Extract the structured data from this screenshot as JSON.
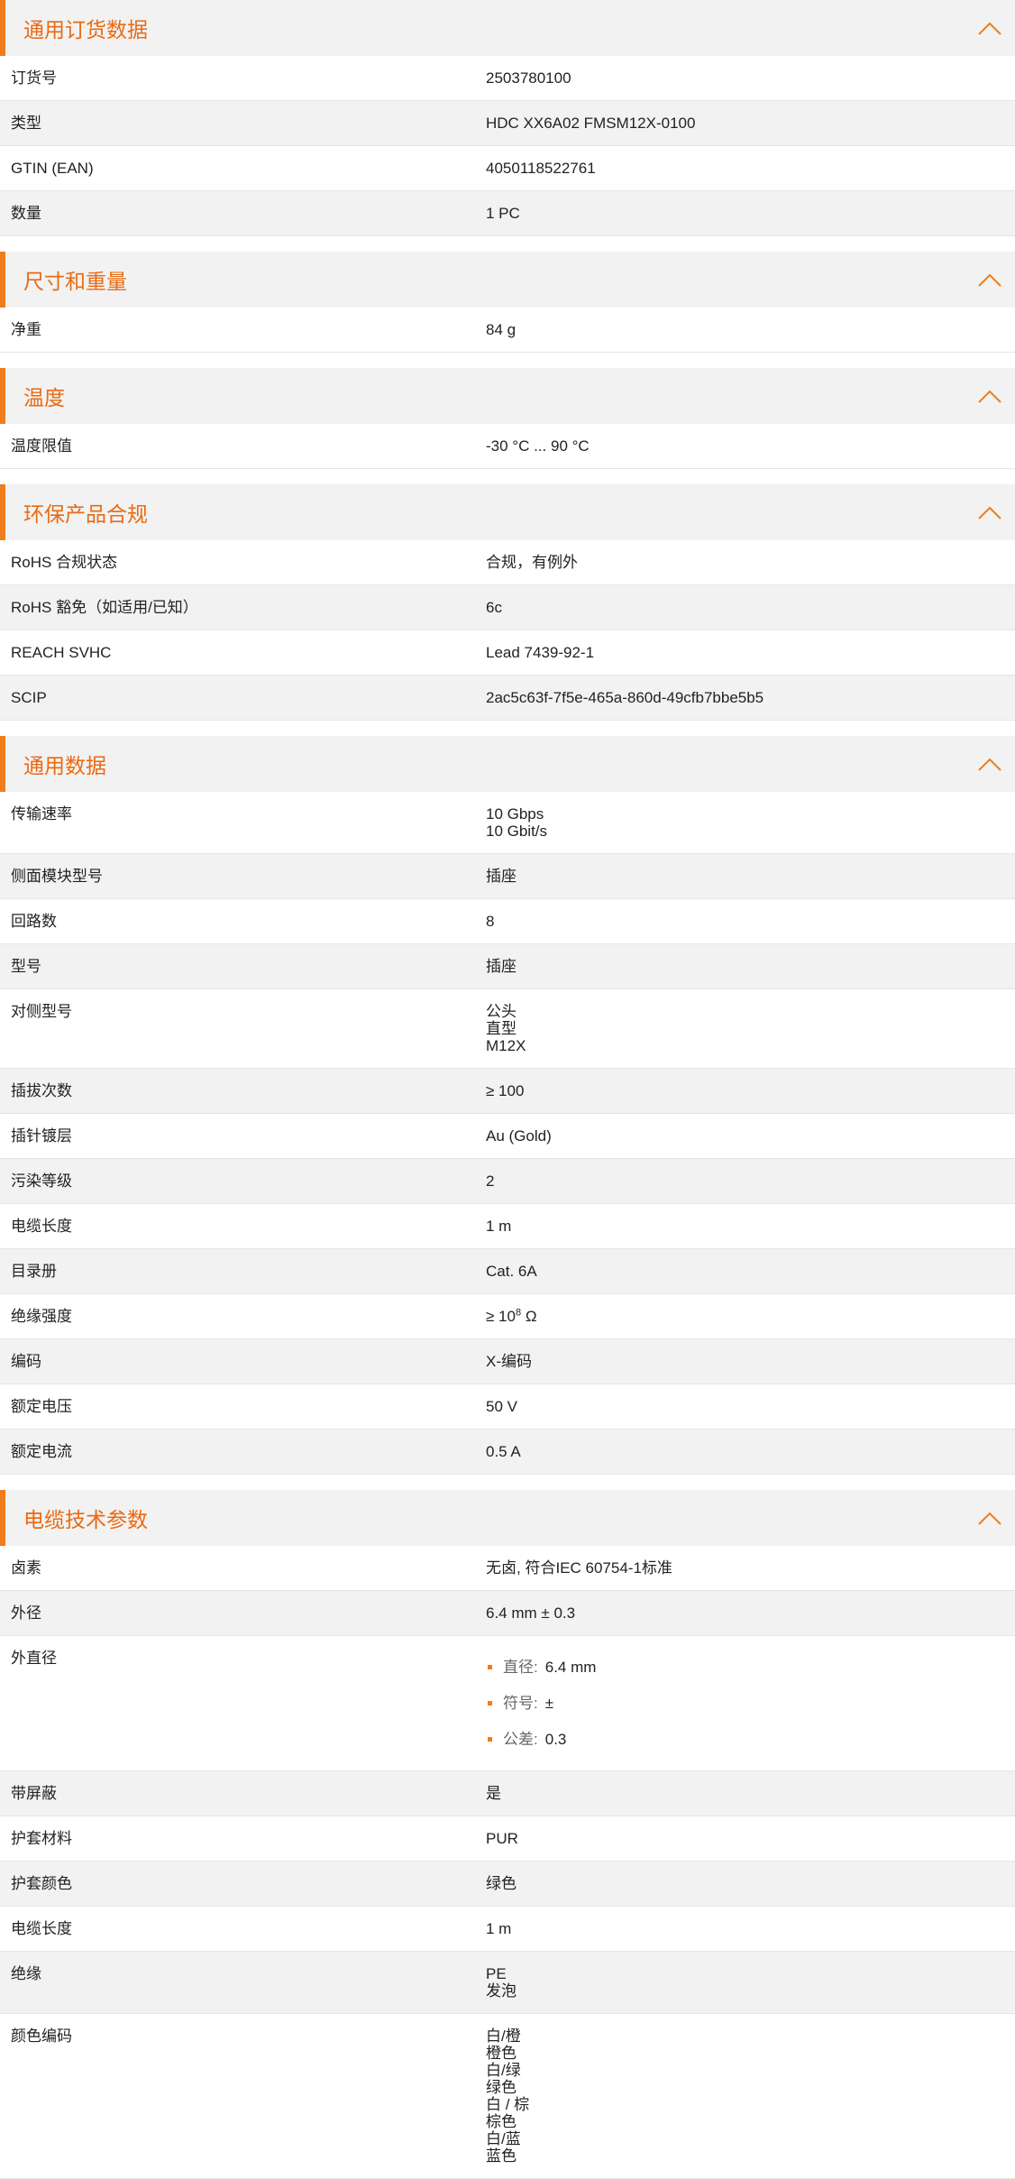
{
  "colors": {
    "accent": "#f07d1b",
    "title": "#ea6a12",
    "row_alt": "#f2f2f2",
    "header_bg": "#f2f2f2"
  },
  "sections": [
    {
      "title": "通用订货数据",
      "icon": "chevron-up-icon",
      "rows": [
        {
          "label": "订货号",
          "lines": [
            "2503780100"
          ]
        },
        {
          "label": "类型",
          "lines": [
            "HDC XX6A02 FMSM12X-0100"
          ]
        },
        {
          "label": "GTIN (EAN)",
          "lines": [
            "4050118522761"
          ]
        },
        {
          "label": "数量",
          "lines": [
            "1  PC"
          ]
        }
      ]
    },
    {
      "title": "尺寸和重量",
      "icon": "chevron-up-icon",
      "rows": [
        {
          "label": "净重",
          "lines": [
            "84  g"
          ]
        }
      ]
    },
    {
      "title": "温度",
      "icon": "chevron-up-icon",
      "rows": [
        {
          "label": "温度限值",
          "lines": [
            "-30 °C ... 90 °C"
          ]
        }
      ]
    },
    {
      "title": "环保产品合规",
      "icon": "chevron-up-icon",
      "rows": [
        {
          "label": "RoHS 合规状态",
          "lines": [
            "合规，有例外"
          ]
        },
        {
          "label": "RoHS 豁免（如适用/已知）",
          "lines": [
            "6c"
          ]
        },
        {
          "label": "REACH SVHC",
          "lines": [
            "Lead 7439-92-1"
          ]
        },
        {
          "label": "SCIP",
          "lines": [
            "2ac5c63f-7f5e-465a-860d-49cfb7bbe5b5"
          ]
        }
      ]
    },
    {
      "title": "通用数据",
      "icon": "chevron-up-icon",
      "rows": [
        {
          "label": "传输速率",
          "lines": [
            "10 Gbps",
            "10 Gbit/s"
          ]
        },
        {
          "label": "侧面模块型号",
          "lines": [
            "插座"
          ]
        },
        {
          "label": "回路数",
          "lines": [
            "8"
          ]
        },
        {
          "label": "型号",
          "lines": [
            "插座"
          ]
        },
        {
          "label": "对侧型号",
          "lines": [
            "公头",
            "直型",
            "M12X"
          ]
        },
        {
          "label": "插拔次数",
          "lines": [
            "≥ 100"
          ]
        },
        {
          "label": "插针镀层",
          "lines": [
            "Au (Gold)"
          ]
        },
        {
          "label": "污染等级",
          "lines": [
            "2"
          ]
        },
        {
          "label": "电缆长度",
          "lines": [
            "1  m"
          ]
        },
        {
          "label": "目录册",
          "lines": [
            "Cat. 6A"
          ]
        },
        {
          "label": "绝缘强度",
          "sup": {
            "base": "≥ 10",
            "exp": "8",
            "unit": " Ω"
          }
        },
        {
          "label": "编码",
          "lines": [
            "X-编码"
          ]
        },
        {
          "label": "额定电压",
          "lines": [
            "50  V"
          ]
        },
        {
          "label": "额定电流",
          "lines": [
            "0.5  A"
          ]
        }
      ]
    },
    {
      "title": "电缆技术参数",
      "icon": "chevron-up-icon",
      "rows": [
        {
          "label": "卤素",
          "lines": [
            "无卤, 符合IEC 60754-1标准"
          ]
        },
        {
          "label": "外径",
          "lines": [
            "6.4 mm ± 0.3"
          ]
        },
        {
          "label": "外直径",
          "bullets": [
            {
              "key": "直径:",
              "val": "6.4 mm"
            },
            {
              "key": "符号:",
              "val": "±"
            },
            {
              "key": "公差:",
              "val": "0.3"
            }
          ]
        },
        {
          "label": "带屏蔽",
          "lines": [
            "是"
          ]
        },
        {
          "label": "护套材料",
          "lines": [
            "PUR"
          ]
        },
        {
          "label": "护套颜色",
          "lines": [
            "绿色"
          ]
        },
        {
          "label": "电缆长度",
          "lines": [
            "1  m"
          ]
        },
        {
          "label": "绝缘",
          "lines": [
            "PE",
            "发泡"
          ]
        },
        {
          "label": "颜色编码",
          "lines": [
            "白/橙",
            "橙色",
            "白/绿",
            "绿色",
            "白 / 棕",
            "棕色",
            "白/蓝",
            "蓝色"
          ]
        }
      ]
    }
  ]
}
